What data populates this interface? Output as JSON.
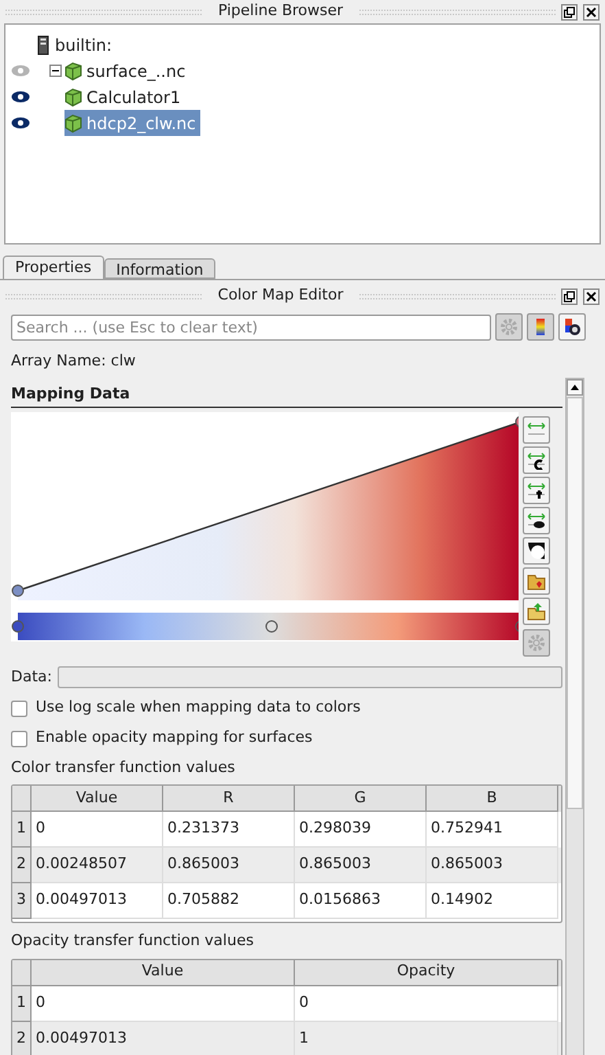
{
  "pipeline_browser": {
    "title": "Pipeline Browser",
    "tree": [
      {
        "label": "builtin:",
        "kind": "server",
        "children": [
          {
            "label": "surface_..nc",
            "kind": "source",
            "visible": false,
            "expanded": true,
            "selected": false,
            "children": [
              {
                "label": "Calculator1",
                "kind": "source",
                "visible": true,
                "selected": false
              }
            ]
          },
          {
            "label": "hdcp2_clw.nc",
            "kind": "source",
            "visible": true,
            "selected": true
          }
        ]
      }
    ]
  },
  "tabs": [
    {
      "label": "Properties",
      "selected": true
    },
    {
      "label": "Information",
      "selected": false
    }
  ],
  "color_map_editor": {
    "title": "Color Map Editor",
    "search": {
      "placeholder": "Search ... (use Esc to clear text)"
    },
    "array_name": "Array Name: clw",
    "section": "Mapping Data",
    "data_label": "Data:",
    "checkboxes": [
      {
        "label": "Use log scale when mapping data to colors",
        "checked": false
      },
      {
        "label": "Enable opacity mapping for surfaces",
        "checked": false
      }
    ],
    "color_table": {
      "title": "Color transfer function values",
      "columns": [
        "Value",
        "R",
        "G",
        "B"
      ],
      "rows": [
        {
          "index": "1",
          "cells": [
            "0",
            "0.231373",
            "0.298039",
            "0.752941"
          ]
        },
        {
          "index": "2",
          "cells": [
            "0.00248507",
            "0.865003",
            "0.865003",
            "0.865003"
          ]
        },
        {
          "index": "3",
          "cells": [
            "0.00497013",
            "0.705882",
            "0.0156863",
            "0.14902"
          ]
        }
      ]
    },
    "opacity_table": {
      "title": "Opacity transfer function values",
      "columns": [
        "Value",
        "Opacity"
      ],
      "rows": [
        {
          "index": "1",
          "cells": [
            "0",
            "0"
          ]
        },
        {
          "index": "2",
          "cells": [
            "0.00497013",
            "1"
          ]
        }
      ]
    }
  }
}
